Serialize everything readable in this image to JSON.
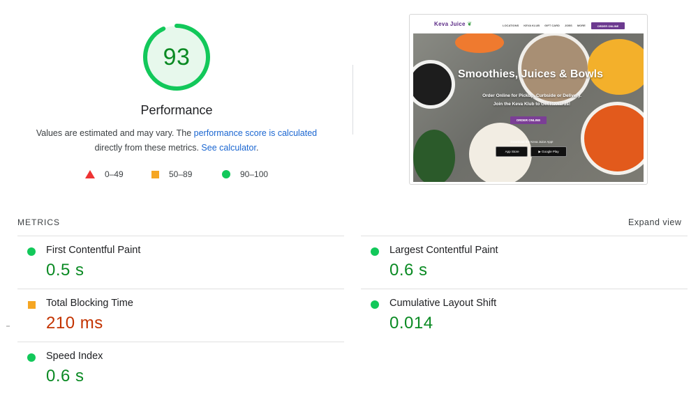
{
  "score": {
    "value": "93",
    "fraction": 0.93,
    "title": "Performance",
    "description_prefix": "Values are estimated and may vary. The ",
    "description_link1": "performance score is calculated",
    "description_middle": "directly from these metrics. ",
    "description_link2": "See calculator",
    "description_suffix": ".",
    "color": "#0a8a23",
    "ring_color": "#12c85a"
  },
  "legend": [
    {
      "icon": "triangle-icon",
      "range": "0–49",
      "color": "#ee3333"
    },
    {
      "icon": "square-icon",
      "range": "50–89",
      "color": "#f5a623"
    },
    {
      "icon": "circle-icon",
      "range": "90–100",
      "color": "#12c85a"
    }
  ],
  "screenshot": {
    "brand": "Keva Juice",
    "nav_links": [
      "LOCATIONS",
      "KEVA KLUB",
      "GIFT CARD",
      "JOBS",
      "MORE"
    ],
    "nav_cta": "ORDER ONLINE",
    "hero_title": "Smoothies, Juices & Bowls",
    "hero_line1": "Order Online for Pickup, Curbside or Delivery.",
    "hero_line2": "Join the Keva Klub to Get Rewards!",
    "hero_cta": "ORDER ONLINE",
    "app_text": "Download the Keva Juice App!",
    "app_store": "App Store",
    "google_play": "Google Play"
  },
  "metrics": {
    "header": "METRICS",
    "expand_label": "Expand view",
    "items": [
      {
        "name": "First Contentful Paint",
        "value": "0.5 s",
        "rating": "good"
      },
      {
        "name": "Largest Contentful Paint",
        "value": "0.6 s",
        "rating": "good"
      },
      {
        "name": "Total Blocking Time",
        "value": "210 ms",
        "rating": "average"
      },
      {
        "name": "Cumulative Layout Shift",
        "value": "0.014",
        "rating": "good"
      },
      {
        "name": "Speed Index",
        "value": "0.6 s",
        "rating": "good"
      }
    ]
  }
}
